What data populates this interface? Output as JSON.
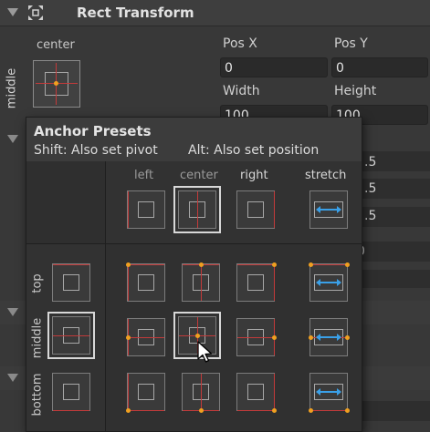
{
  "header": {
    "title": "Rect Transform"
  },
  "anchor": {
    "horizontal_label": "center",
    "vertical_label": "middle"
  },
  "fields": {
    "pos_x_label": "Pos X",
    "pos_y_label": "Pos Y",
    "pos_x_value": "0",
    "pos_y_value": "0",
    "width_label": "Width",
    "height_label": "Height",
    "width_value": "100",
    "height_value": "100"
  },
  "background_values": [
    ".5",
    ".5",
    ".5",
    "0"
  ],
  "popup": {
    "title": "Anchor Presets",
    "hint_shift": "Shift: Also set pivot",
    "hint_alt": "Alt: Also set position",
    "columns": [
      "left",
      "center",
      "right",
      "stretch"
    ],
    "rows": [
      "top",
      "middle",
      "bottom"
    ],
    "selected_column": "center",
    "selected_row": "middle"
  },
  "colors": {
    "anchor_line": "#c23a3a",
    "pivot_dot": "#f0a020",
    "stretch_arrow": "#3aa0e8"
  },
  "icons": [
    "collapse-arrow-icon",
    "rect-transform-icon",
    "mouse-cursor-icon"
  ]
}
